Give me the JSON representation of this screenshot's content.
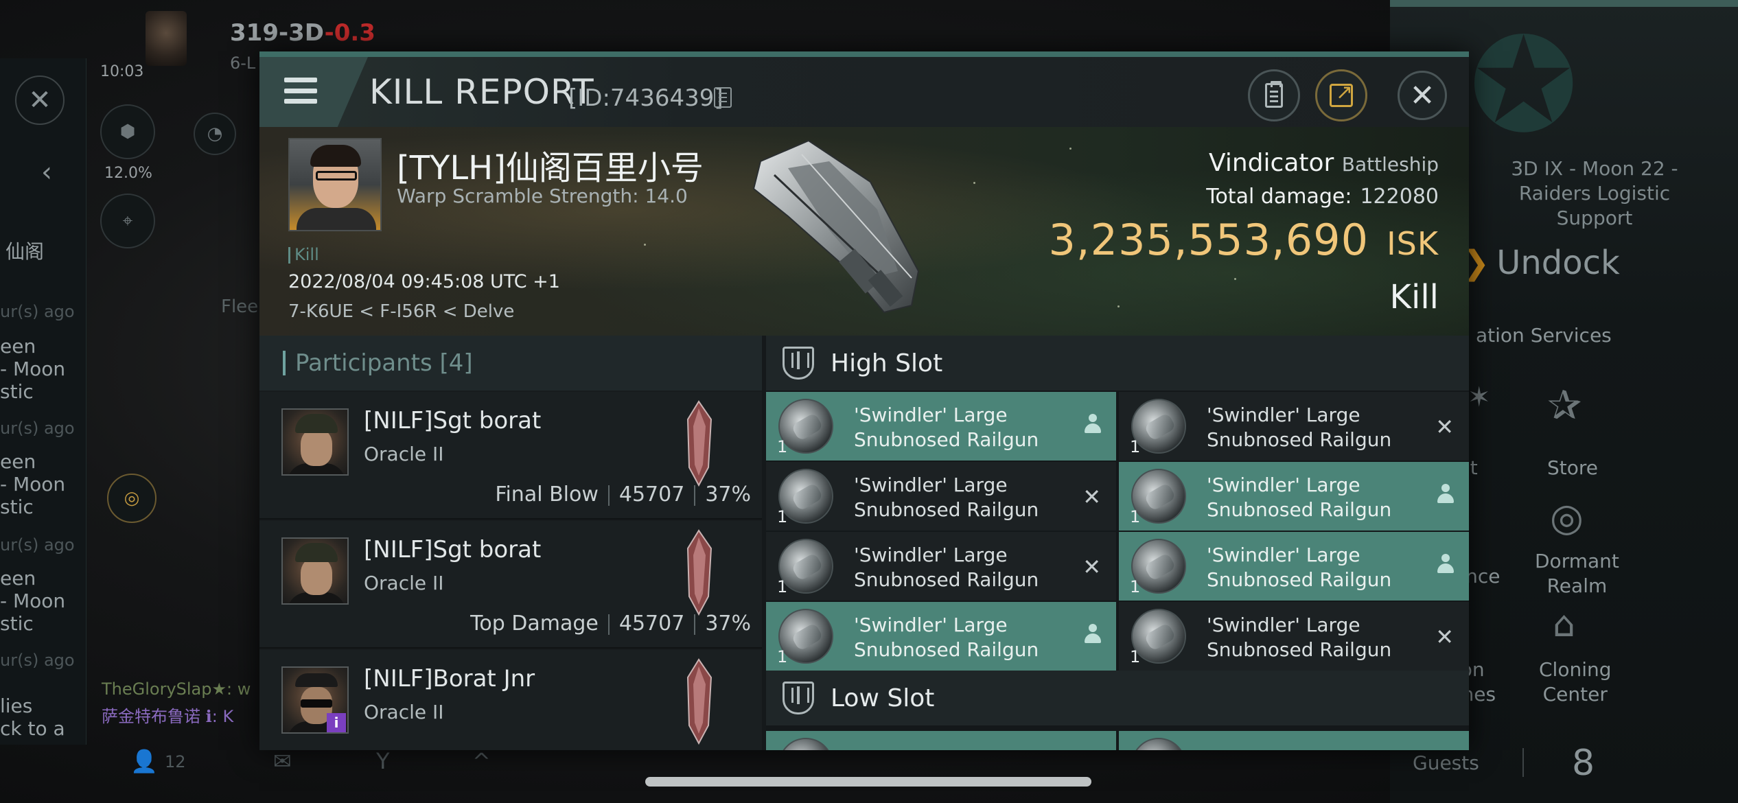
{
  "background": {
    "pilot_system": "319-3D",
    "security": "-0.3",
    "subtitle": "6-L",
    "clock": "10:03",
    "percent": "12.0%",
    "left_chat": [
      {
        "text": "仙阁",
        "dim": false
      },
      {
        "text": "ur(s) ago",
        "dim": true
      },
      {
        "text": "een\n- Moon\nstic",
        "dim": false
      },
      {
        "text": "ur(s) ago",
        "dim": true
      },
      {
        "text": "een\n- Moon\nstic",
        "dim": false
      },
      {
        "text": "ur(s) ago",
        "dim": true
      },
      {
        "text": "een\n- Moon\nstic",
        "dim": false
      },
      {
        "text": "ur(s) ago",
        "dim": true
      },
      {
        "text": "lies\nck to a",
        "dim": false
      }
    ],
    "fleet_label": "Flee",
    "chat_lines": [
      "TheGlorySlap★: w",
      "萨金特布鲁诺 ℹ: K"
    ],
    "bottom_count": "12",
    "station_location": "3D IX - Moon 22 -\nRaiders Logistic\nSupport",
    "undock_label": "Undock",
    "services_label": "ation Services",
    "store_label": "Store",
    "agent_label": "nt",
    "insurance_label": "ance",
    "dormant_label": "Dormant\nRealm",
    "cloning_label": "Cloning\nCenter",
    "station_label": "ion\nmes",
    "guests_label": "Guests",
    "guests_count": "8"
  },
  "modal": {
    "title": "KILL REPORT",
    "id": "[ID:7436439]",
    "close_icon": "close-icon",
    "copy_icon": "copy-icon",
    "clipboard_icon": "clipboard-icon",
    "share_icon": "share-icon"
  },
  "victim": {
    "name": "[TYLH]仙阁百里小号",
    "warp": "Warp Scramble Strength: 14.0",
    "tag": "Kill",
    "date": "2022/08/04 09:45:08 UTC +1",
    "location": "7-K6UE < F-I56R < Delve",
    "ship_name": "Vindicator",
    "ship_class": "Battleship",
    "total_damage_label": "Total damage:",
    "total_damage": "122080",
    "isk": "3,235,553,690",
    "isk_unit": "ISK",
    "result": "Kill"
  },
  "participants": {
    "title": "Participants [4]",
    "rows": [
      {
        "name": "[NILF]Sgt borat",
        "ship": "Oracle II",
        "role": "Final Blow",
        "damage": "45707",
        "pct": "37%"
      },
      {
        "name": "[NILF]Sgt borat",
        "ship": "Oracle II",
        "role": "Top Damage",
        "damage": "45707",
        "pct": "37%"
      },
      {
        "name": "[NILF]Borat Jnr",
        "ship": "Oracle II",
        "role": "",
        "damage": "",
        "pct": ""
      }
    ]
  },
  "fitting": {
    "high_slot_label": "High Slot",
    "low_slot_label": "Low Slot",
    "module_name_line1": "'Swindler' Large",
    "module_name_line2": "Snubnosed Railgun",
    "qty": "1",
    "modules": [
      {
        "state": "dropped"
      },
      {
        "state": "destroyed"
      },
      {
        "state": "destroyed"
      },
      {
        "state": "dropped"
      },
      {
        "state": "destroyed"
      },
      {
        "state": "dropped"
      },
      {
        "state": "dropped"
      },
      {
        "state": "destroyed"
      }
    ],
    "low_modules_partial": [
      {
        "state": "dropped"
      },
      {
        "state": "dropped"
      }
    ],
    "colors": {
      "dropped": "#4b8478",
      "destroyed": "#1c2123"
    }
  }
}
